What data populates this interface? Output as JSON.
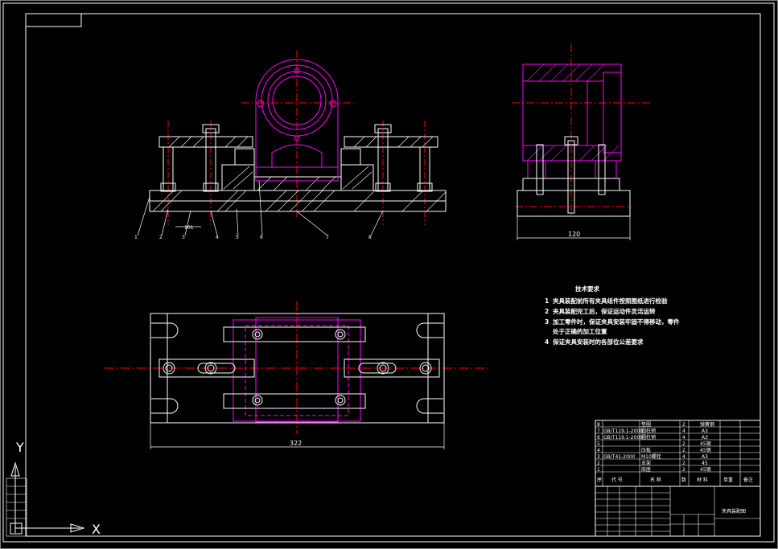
{
  "drawing": {
    "colors": {
      "background": "#000000",
      "outline": "#ffffff",
      "part": "#ff00ff",
      "centerline": "#ff0000",
      "text": "#ffffff"
    },
    "front_view": {
      "part_labels": [
        "1",
        "2",
        "3",
        "4",
        "5",
        "6",
        "7",
        "8"
      ],
      "dimension": "101"
    },
    "side_view": {
      "dimension": "120"
    },
    "top_view": {
      "dimension": "322"
    },
    "technical_requirements": {
      "title": "技术要求",
      "items": [
        {
          "num": "1",
          "text": "夹具装配前所有夹具组件按照图纸进行检验"
        },
        {
          "num": "2",
          "text": "夹具装配完工后，保证运动件灵活运转"
        },
        {
          "num": "3",
          "text": "加工零件时，保证夹具安装牢固不得移动，零件"
        },
        {
          "num": "",
          "text": "处于正确的加工位置"
        },
        {
          "num": "4",
          "text": "保证夹具安装时的各部位公差要求"
        }
      ]
    },
    "bom": {
      "rows": [
        {
          "no": "8",
          "code": "",
          "name": "垫圈",
          "qty": "2",
          "material": "弹簧钢"
        },
        {
          "no": "7",
          "code": "GB/T119.1-2000",
          "name": "圆柱销",
          "qty": "4",
          "material": "A3"
        },
        {
          "no": "6",
          "code": "GB/T119.1-2000",
          "name": "圆柱销",
          "qty": "4",
          "material": "A3"
        },
        {
          "no": "5",
          "code": "",
          "name": "",
          "qty": "2",
          "material": "45钢"
        },
        {
          "no": "4",
          "code": "",
          "name": "压板",
          "qty": "2",
          "material": "45钢"
        },
        {
          "no": "3",
          "code": "GB/T41-2000",
          "name": "M10螺栓",
          "qty": "4",
          "material": "A3"
        },
        {
          "no": "2",
          "code": "",
          "name": "支架",
          "qty": "2",
          "material": "45"
        },
        {
          "no": "1",
          "code": "",
          "name": "底座",
          "qty": "2",
          "material": "45钢"
        }
      ],
      "header": [
        "序",
        "代 号",
        "名 称",
        "数",
        "材 料",
        "单重",
        "备注"
      ],
      "title": "夹具装配图"
    },
    "ucs": {
      "x": "X",
      "y": "Y"
    }
  }
}
